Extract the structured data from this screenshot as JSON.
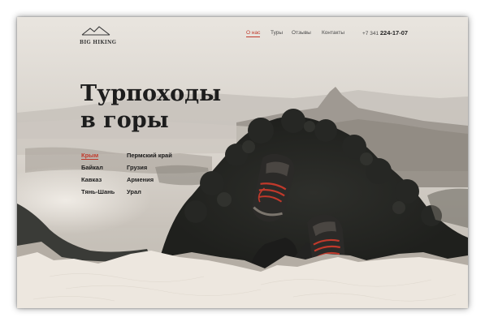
{
  "logo": {
    "text": "BIG HIKING"
  },
  "nav": {
    "items": [
      {
        "label": "О нас",
        "active": true
      },
      {
        "label": "Туры",
        "active": false
      },
      {
        "label": "Отзывы",
        "active": false
      },
      {
        "label": "Контакты",
        "active": false
      }
    ]
  },
  "phone": {
    "prefix": "+7 341",
    "number": "224-17-07"
  },
  "hero": {
    "title_line1": "Турпоходы",
    "title_line2": "в горы"
  },
  "regions": {
    "col1": [
      "Крым",
      "Байкал",
      "Кавказ",
      "Тянь-Шань"
    ],
    "col2": [
      "Пермский край",
      "Грузия",
      "Армения",
      "Урал"
    ],
    "active": "Крым"
  },
  "colors": {
    "accent": "#c0392b",
    "text": "#1d1d1d",
    "sand": "#efe9e1",
    "sand_dark": "#a9a096"
  }
}
